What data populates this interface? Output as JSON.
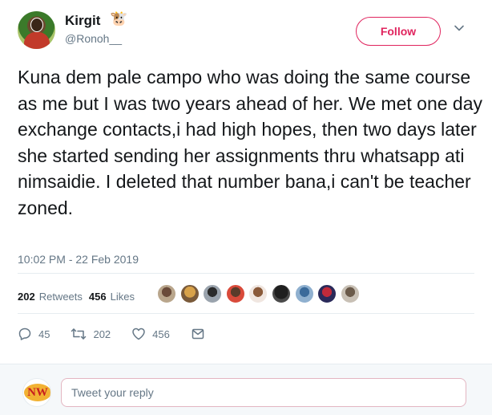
{
  "author": {
    "name": "Kirgit",
    "emoji": "🐮",
    "handle": "@Ronoh__"
  },
  "follow_label": "Follow",
  "tweet": {
    "text": "Kuna dem pale campo who was doing the same course as me but I was two years ahead of her. We met one day exchange contacts,i had high hopes, then two days later she started sending her assignments thru whatsapp ati nimsaidie. I deleted that number bana,i can't be teacher zoned.",
    "timestamp": "10:02 PM - 22 Feb 2019"
  },
  "stats": {
    "retweets_count": "202",
    "retweets_label": "Retweets",
    "likes_count": "456",
    "likes_label": "Likes"
  },
  "likers_icons": [
    "avatar-1",
    "avatar-2",
    "avatar-3",
    "avatar-4",
    "avatar-5",
    "avatar-6",
    "avatar-7",
    "avatar-8",
    "avatar-9"
  ],
  "actions": {
    "reply_count": "45",
    "retweet_count": "202",
    "like_count": "456"
  },
  "reply_box": {
    "avatar_text": "NW",
    "placeholder": "Tweet your reply"
  },
  "colors": {
    "follow_accent": "#e0245e",
    "secondary_text": "#657786",
    "primary_text": "#14171a"
  }
}
